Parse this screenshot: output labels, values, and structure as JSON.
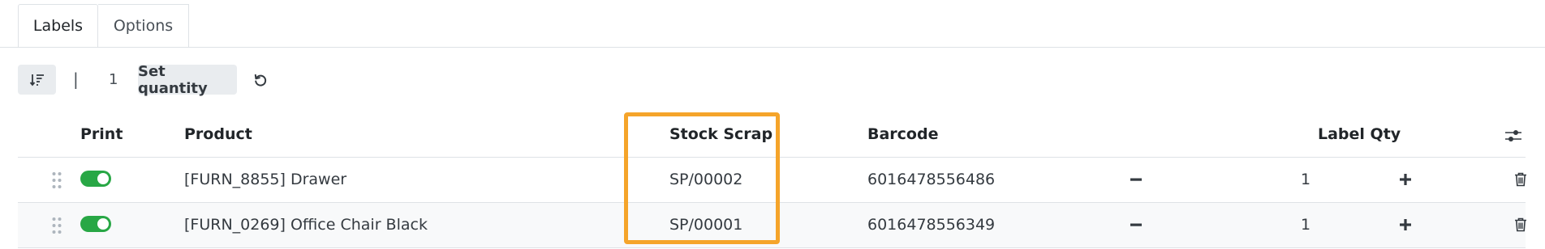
{
  "tabs": [
    {
      "label": "Labels",
      "active": true
    },
    {
      "label": "Options",
      "active": false
    }
  ],
  "toolbar": {
    "separator": "|",
    "quantity": "1",
    "set_quantity_label": "Set quantity"
  },
  "table": {
    "headers": {
      "print": "Print",
      "product": "Product",
      "stock_scrap": "Stock Scrap",
      "barcode": "Barcode",
      "label_qty": "Label Qty"
    },
    "rows": [
      {
        "print": true,
        "product": "[FURN_8855] Drawer",
        "stock_scrap": "SP/00002",
        "barcode": "6016478556486",
        "label_qty": "1"
      },
      {
        "print": true,
        "product": "[FURN_0269] Office Chair Black",
        "stock_scrap": "SP/00001",
        "barcode": "6016478556349",
        "label_qty": "1"
      }
    ]
  },
  "colors": {
    "toggle_on": "#28a745",
    "highlight": "#f5a42a",
    "button_bg": "#e9ecef"
  },
  "icons": [
    "sort-icon",
    "reset-icon",
    "column-settings-icon",
    "drag-handle-icon",
    "minus-icon",
    "plus-icon",
    "trash-icon"
  ]
}
